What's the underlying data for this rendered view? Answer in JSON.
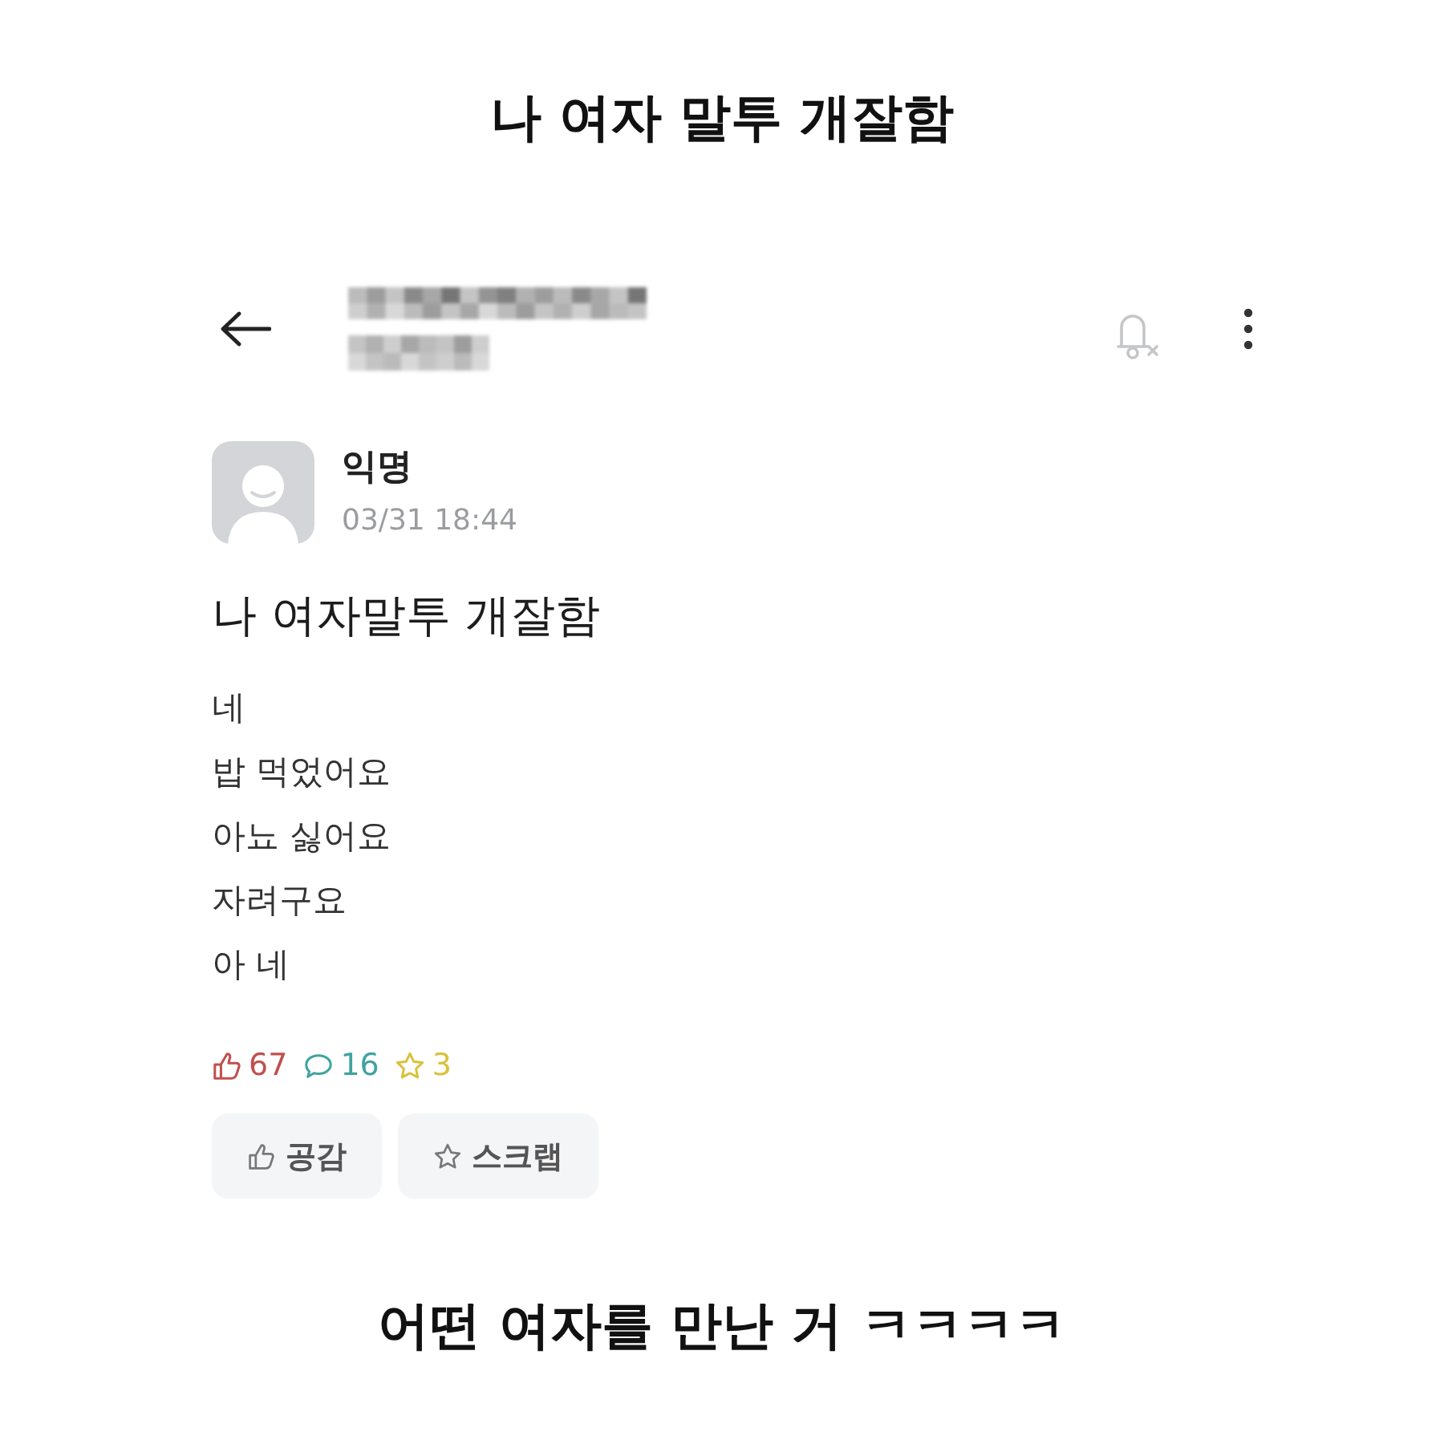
{
  "caption_top": "나 여자 말투 개잘함",
  "post": {
    "author": "익명",
    "time": "03/31 18:44",
    "title": "나 여자말투 개잘함",
    "body": [
      "네",
      "밥 먹었어요",
      "아뇨 싫어요",
      "자려구요",
      "아 네"
    ],
    "stats": [
      {
        "kind": "likes",
        "value": "67",
        "color": "#c0504e"
      },
      {
        "kind": "comments",
        "value": "16",
        "color": "#3fa3a0"
      },
      {
        "kind": "scraps",
        "value": "3",
        "color": "#d8c23c"
      }
    ],
    "actions": [
      {
        "kind": "like",
        "label": "공감"
      },
      {
        "kind": "scrap",
        "label": "스크랩"
      }
    ]
  },
  "caption_bottom": "어떤 여자를 만난 거 ㅋㅋㅋㅋ"
}
